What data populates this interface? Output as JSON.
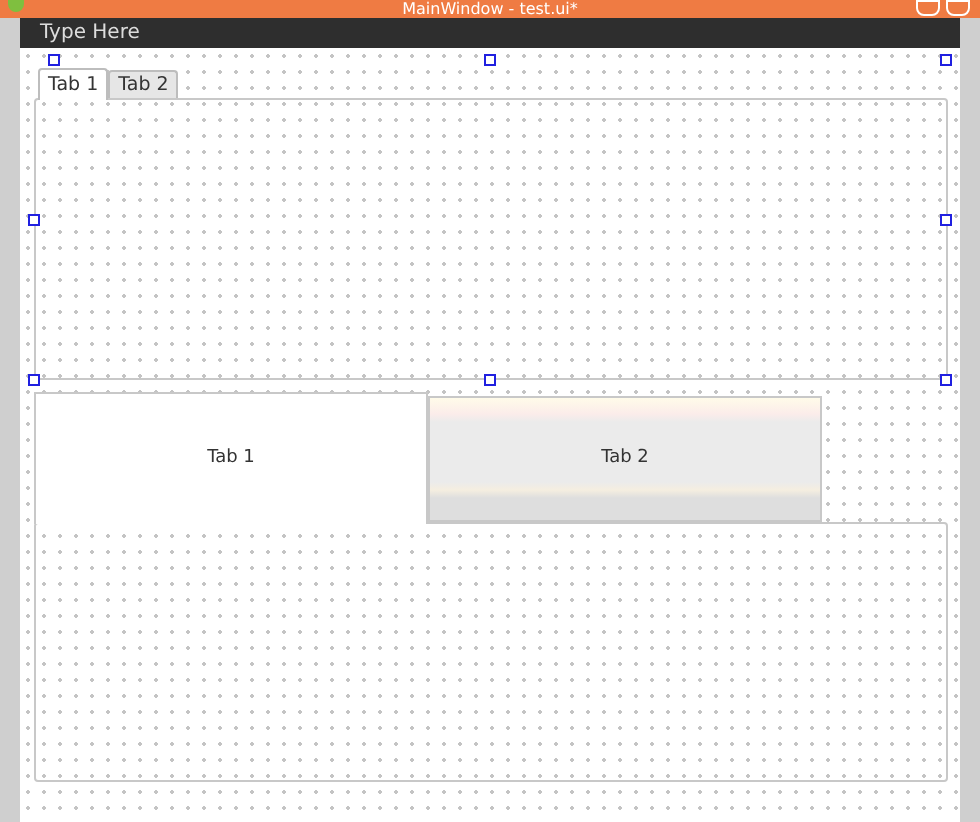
{
  "window": {
    "title": "MainWindow - test.ui*"
  },
  "menu_bar": {
    "placeholder_item": "Type Here"
  },
  "tab_widget_1": {
    "tabs": [
      {
        "label": "Tab 1",
        "selected": true
      },
      {
        "label": "Tab 2",
        "selected": false
      }
    ]
  },
  "tab_widget_2": {
    "tabs": [
      {
        "label": "Tab 1",
        "selected": true
      },
      {
        "label": "Tab 2",
        "selected": false
      }
    ]
  }
}
